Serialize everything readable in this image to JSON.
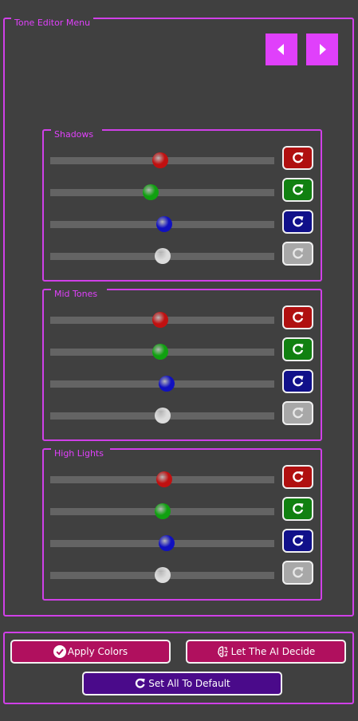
{
  "menu": {
    "title": "Tone Editor Menu"
  },
  "nav": {
    "prev_icon": "triangle-left-icon",
    "next_icon": "triangle-right-icon"
  },
  "groups": [
    {
      "title": "Shadows",
      "sliders": [
        {
          "channel": "red",
          "value": 0.49,
          "color": "#c01010"
        },
        {
          "channel": "green",
          "value": 0.45,
          "color": "#10a010"
        },
        {
          "channel": "blue",
          "value": 0.51,
          "color": "#1010c0"
        },
        {
          "channel": "gray",
          "value": 0.5,
          "color": "#dcdcdc"
        }
      ]
    },
    {
      "title": "Mid Tones",
      "sliders": [
        {
          "channel": "red",
          "value": 0.49,
          "color": "#c01010"
        },
        {
          "channel": "green",
          "value": 0.49,
          "color": "#10a010"
        },
        {
          "channel": "blue",
          "value": 0.52,
          "color": "#1010c0"
        },
        {
          "channel": "gray",
          "value": 0.5,
          "color": "#dcdcdc"
        }
      ]
    },
    {
      "title": "High Lights",
      "sliders": [
        {
          "channel": "red",
          "value": 0.51,
          "color": "#c01010"
        },
        {
          "channel": "green",
          "value": 0.5,
          "color": "#10a010"
        },
        {
          "channel": "blue",
          "value": 0.52,
          "color": "#1010c0"
        },
        {
          "channel": "gray",
          "value": 0.5,
          "color": "#dcdcdc"
        }
      ]
    }
  ],
  "reset_colors": {
    "red": "#b01010",
    "green": "#118011",
    "blue": "#10108a",
    "gray": "#a8a8a8"
  },
  "buttons": {
    "apply": "Apply Colors",
    "ai": "Let The AI Decide",
    "default": "Set All To Default",
    "apply_color": "#b0105e",
    "ai_color": "#b0105e",
    "default_color": "#4a0a8a"
  }
}
